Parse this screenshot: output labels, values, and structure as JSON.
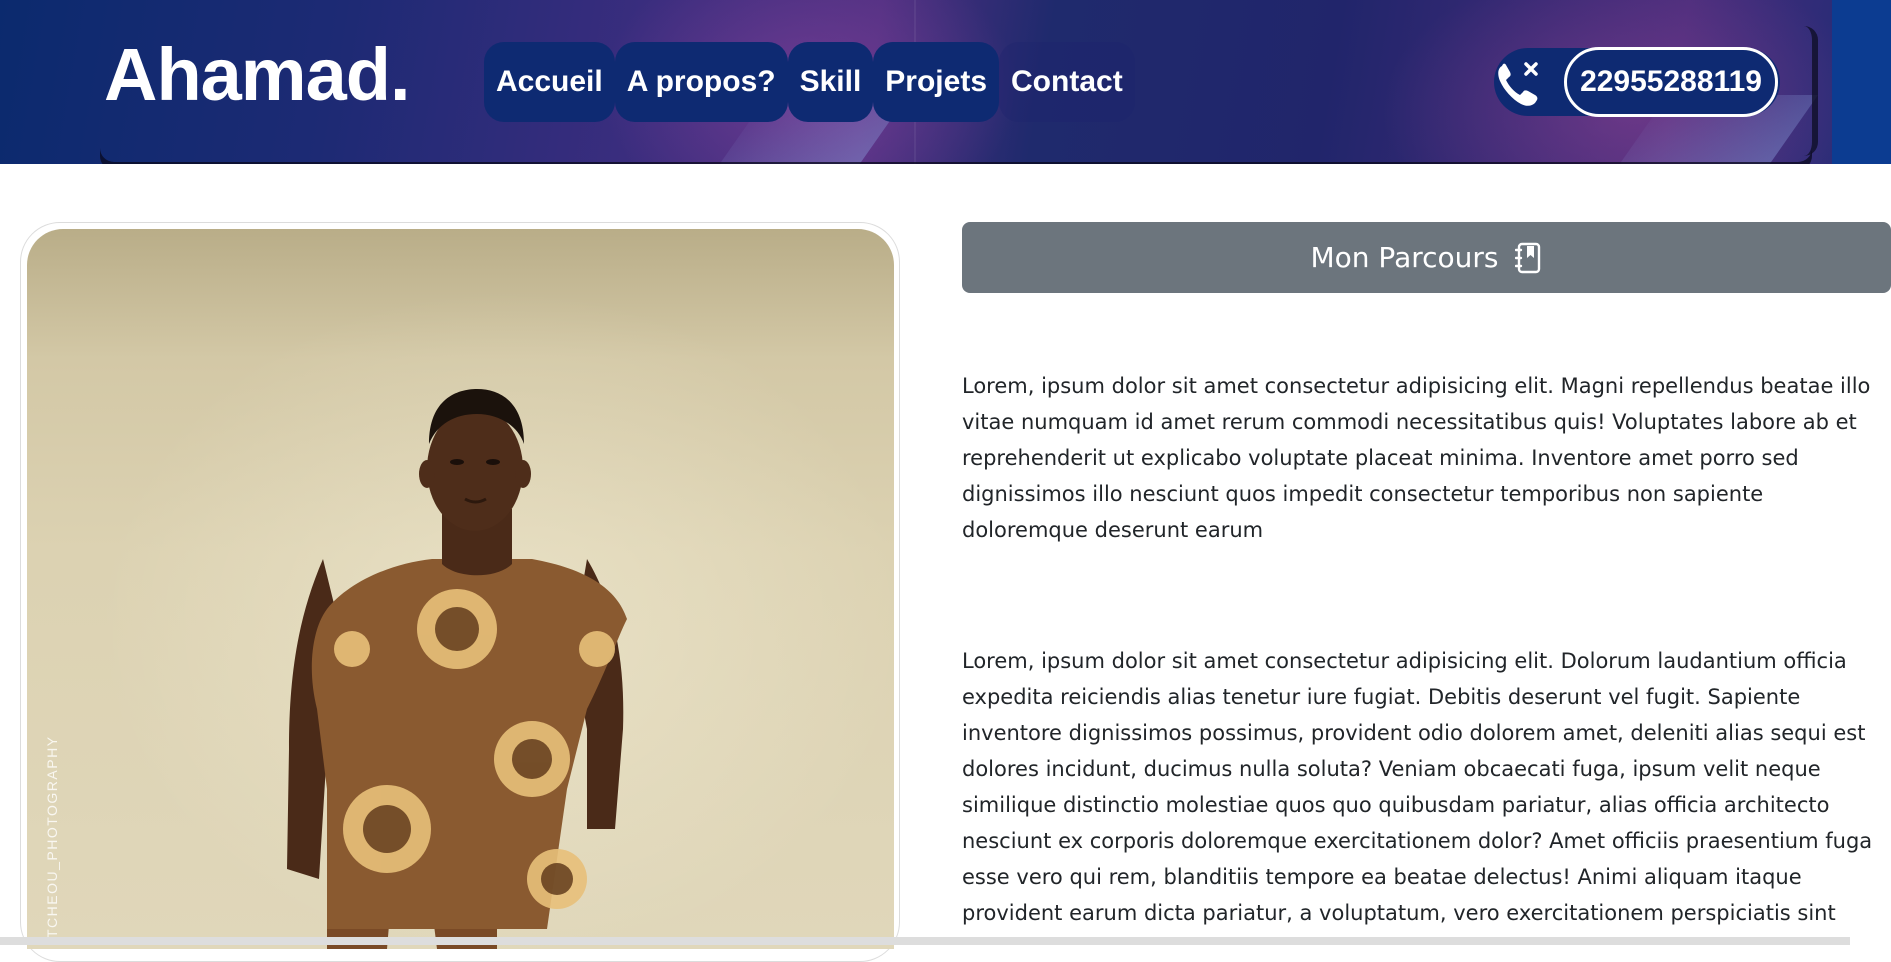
{
  "header": {
    "brand": "Ahamad.",
    "nav": [
      {
        "label": "Accueil"
      },
      {
        "label": "A propos?"
      },
      {
        "label": "Skill"
      },
      {
        "label": "Projets"
      },
      {
        "label": "Contact"
      }
    ],
    "phone": {
      "number": "22955288119",
      "icon": "phone-x-icon"
    }
  },
  "photo": {
    "watermark": "TCHEOU_PHOTOGRAPHY"
  },
  "main": {
    "parcours_button": {
      "label": "Mon Parcours",
      "icon": "journal-bookmark-icon"
    },
    "paragraphs": [
      "Lorem, ipsum dolor sit amet consectetur adipisicing elit. Magni repellendus beatae illo vitae numquam id amet rerum commodi necessitatibus quis! Voluptates labore ab et reprehenderit ut explicabo voluptate placeat minima. Inventore amet porro sed dignissimos illo nesciunt quos impedit consectetur temporibus non sapiente doloremque deserunt earum",
      "Lorem, ipsum dolor sit amet consectetur adipisicing elit. Dolorum laudantium officia expedita reiciendis alias tenetur iure fugiat. Debitis deserunt vel fugit. Sapiente inventore dignissimos possimus, provident odio dolorem amet, deleniti alias sequi est dolores incidunt, ducimus nulla soluta? Veniam obcaecati fuga, ipsum velit neque similique distinctio molestiae quos quo quibusdam pariatur, alias officia architecto nesciunt ex corporis doloremque exercitationem dolor? Amet officiis praesentium fuga esse vero qui rem, blanditiis tempore ea beatae delectus! Animi aliquam itaque provident earum dicta pariatur, a voluptatum, vero exercitationem perspiciatis sint"
    ]
  },
  "colors": {
    "nav_pill": "#0e2a72",
    "button_secondary": "#6c757d",
    "text": "#212529"
  }
}
